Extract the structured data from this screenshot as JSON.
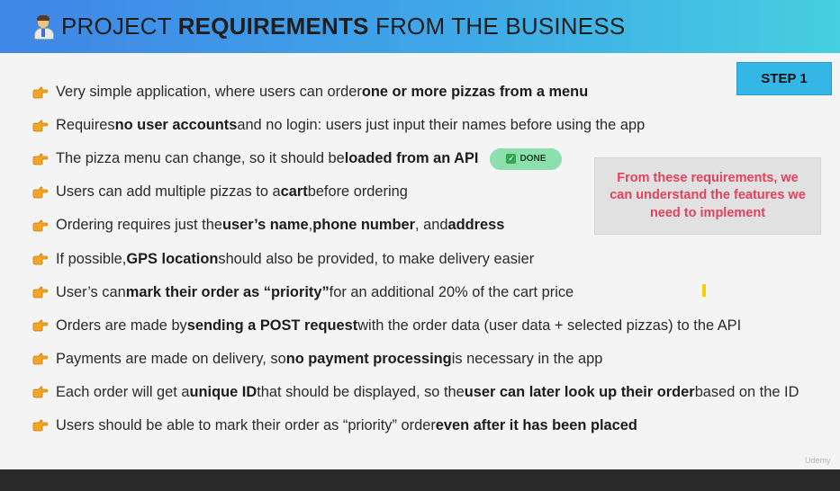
{
  "header": {
    "icon": "person-icon",
    "title_prefix": "PROJECT ",
    "title_bold": "REQUIREMENTS",
    "title_suffix": " FROM THE BUSINESS"
  },
  "step_badge": "STEP 1",
  "pointer_icon": "hand-pointing-right-icon",
  "requirements": [
    {
      "parts": [
        {
          "t": "Very simple application, where users can order ",
          "b": false
        },
        {
          "t": "one or more pizzas from a menu",
          "b": true
        }
      ]
    },
    {
      "parts": [
        {
          "t": "Requires ",
          "b": false
        },
        {
          "t": "no user accounts",
          "b": true
        },
        {
          "t": " and no login: users just input their names before using the app",
          "b": false
        }
      ]
    },
    {
      "parts": [
        {
          "t": "The pizza menu can change, so it should be ",
          "b": false
        },
        {
          "t": "loaded from an API",
          "b": true
        }
      ]
    },
    {
      "parts": [
        {
          "t": "Users can add multiple pizzas to a ",
          "b": false
        },
        {
          "t": "cart",
          "b": true
        },
        {
          "t": " before ordering",
          "b": false
        }
      ]
    },
    {
      "parts": [
        {
          "t": "Ordering requires just the ",
          "b": false
        },
        {
          "t": "user’s name",
          "b": true
        },
        {
          "t": ", ",
          "b": false
        },
        {
          "t": "phone number",
          "b": true
        },
        {
          "t": ", and ",
          "b": false
        },
        {
          "t": "address",
          "b": true
        }
      ]
    },
    {
      "parts": [
        {
          "t": "If possible, ",
          "b": false
        },
        {
          "t": "GPS location",
          "b": true
        },
        {
          "t": " should also be provided, to make delivery easier",
          "b": false
        }
      ]
    },
    {
      "parts": [
        {
          "t": "User’s can ",
          "b": false
        },
        {
          "t": "mark their order as “priority”",
          "b": true
        },
        {
          "t": " for an additional 20% of the cart price",
          "b": false
        }
      ]
    },
    {
      "parts": [
        {
          "t": "Orders are made by ",
          "b": false
        },
        {
          "t": "sending a POST request",
          "b": true
        },
        {
          "t": " with the order data (user data + selected pizzas) to the API",
          "b": false
        }
      ]
    },
    {
      "parts": [
        {
          "t": "Payments are made on delivery, so ",
          "b": false
        },
        {
          "t": "no payment processing",
          "b": true
        },
        {
          "t": " is necessary in the app",
          "b": false
        }
      ]
    },
    {
      "parts": [
        {
          "t": "Each order will get a ",
          "b": false
        },
        {
          "t": "unique ID",
          "b": true
        },
        {
          "t": " that should be displayed, so the ",
          "b": false
        },
        {
          "t": "user can later look up their order",
          "b": true
        },
        {
          "t": " based on the ID",
          "b": false
        }
      ]
    },
    {
      "parts": [
        {
          "t": "Users should be able to mark their order as “priority” order ",
          "b": false
        },
        {
          "t": "even after it has been placed",
          "b": true
        }
      ]
    }
  ],
  "done_badge": {
    "label": "DONE",
    "icon": "check-mark-icon",
    "color": "#8be0ae"
  },
  "note": "From these requirements, we can understand the features we need to implement",
  "watermark": "Udemy",
  "colors": {
    "header_start": "#3f86e6",
    "header_end": "#45cfe0",
    "step_badge": "#34b6e6",
    "note_text": "#e3415c"
  }
}
